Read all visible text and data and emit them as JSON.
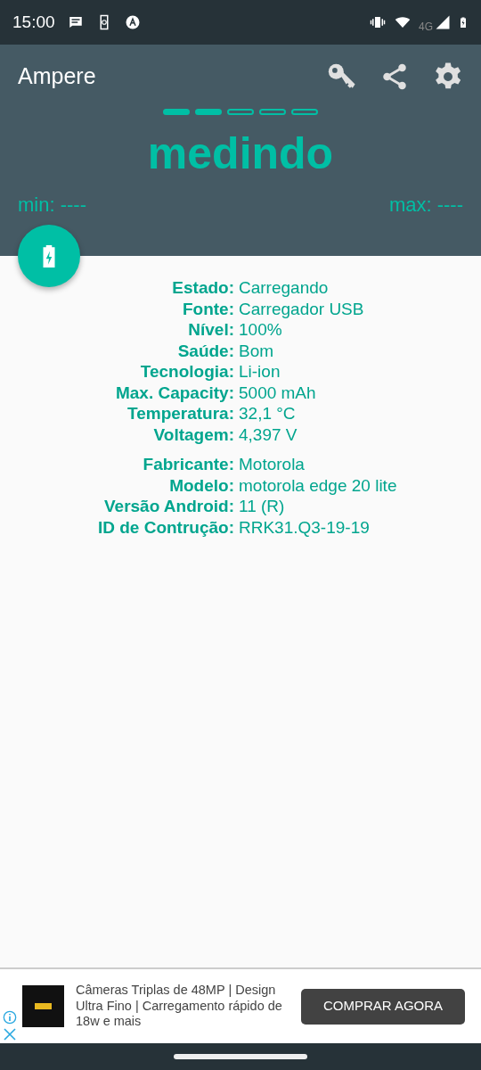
{
  "status_bar": {
    "time": "15:00",
    "network": "4G"
  },
  "app_bar": {
    "title": "Ampere"
  },
  "progress": [
    {
      "filled": true
    },
    {
      "filled": true
    },
    {
      "filled": false
    },
    {
      "filled": false
    },
    {
      "filled": false
    }
  ],
  "reading": "medindo",
  "min": "min: ----",
  "max": "max: ----",
  "info_groups": [
    {
      "rows": [
        {
          "label": "Estado:",
          "value": "Carregando"
        },
        {
          "label": "Fonte:",
          "value": "Carregador USB"
        },
        {
          "label": "Nível:",
          "value": "100%"
        },
        {
          "label": "Saúde:",
          "value": "Bom"
        },
        {
          "label": "Tecnologia:",
          "value": "Li-ion"
        },
        {
          "label": "Max. Capacity:",
          "value": "5000 mAh"
        },
        {
          "label": "Temperatura:",
          "value": "32,1 °C"
        },
        {
          "label": "Voltagem:",
          "value": "4,397 V"
        }
      ]
    },
    {
      "rows": [
        {
          "label": "Fabricante:",
          "value": "Motorola"
        },
        {
          "label": "Modelo:",
          "value": "motorola edge 20 lite"
        },
        {
          "label": "Versão Android:",
          "value": "11 (R)"
        },
        {
          "label": "ID de Contrução:",
          "value": "RRK31.Q3-19-19"
        }
      ]
    }
  ],
  "ad": {
    "text": "Câmeras Triplas de 48MP | Design Ultra Fino | Carregamento rápido de 18w e mais",
    "button": "COMPRAR AGORA"
  }
}
